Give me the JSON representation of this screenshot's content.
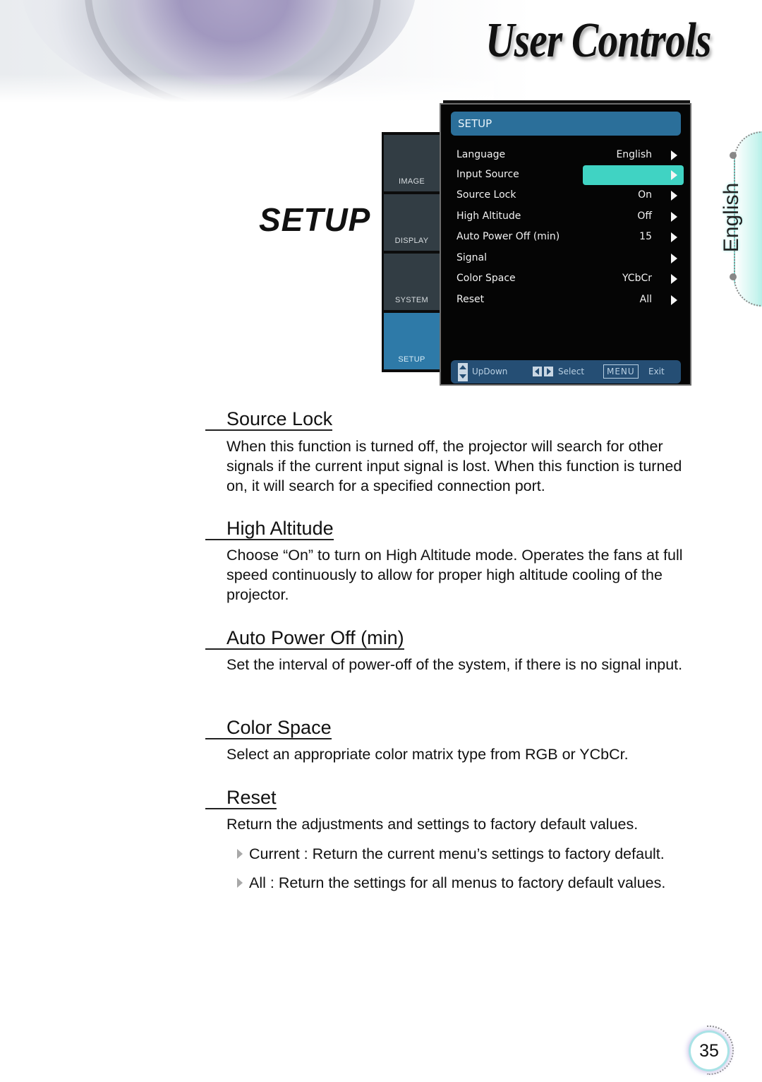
{
  "header": {
    "title": "User Controls"
  },
  "section": {
    "title": "SETUP"
  },
  "osd": {
    "tabs": [
      {
        "label": "IMAGE",
        "active": false
      },
      {
        "label": "DISPLAY",
        "active": false
      },
      {
        "label": "SYSTEM",
        "active": false
      },
      {
        "label": "SETUP",
        "active": true
      }
    ],
    "menu_title": "SETUP",
    "items": [
      {
        "label": "Language",
        "value": "English"
      },
      {
        "label": "Input Source",
        "value": "",
        "highlighted": true
      },
      {
        "label": "Source Lock",
        "value": "On"
      },
      {
        "label": "High Altitude",
        "value": "Off"
      },
      {
        "label": "Auto Power Off (min)",
        "value": "15"
      },
      {
        "label": "Signal",
        "value": ""
      },
      {
        "label": "Color Space",
        "value": "YCbCr"
      },
      {
        "label": "Reset",
        "value": "All"
      }
    ],
    "footer": {
      "updown_label": "UpDown",
      "select_label": "Select",
      "menu_key": "MENU",
      "exit_label": "Exit"
    },
    "colors": {
      "header_bg": "#2b6f9a",
      "highlight": "#40d3c3",
      "active_tab": "#2e7aa8",
      "footer_bg": "#254e74"
    }
  },
  "language_tab": {
    "label": "English"
  },
  "sections": [
    {
      "heading": "Source Lock",
      "body": "When this function is turned off, the projector will search for other signals if the current input signal is lost. When this function is turned on, it will search for a specified connection port."
    },
    {
      "heading": "High Altitude",
      "body": "Choose “On” to turn on High Altitude mode. Operates the fans at full speed continuously to allow for proper high altitude cooling of the projector."
    },
    {
      "heading": "Auto Power Off (min)",
      "body": "Set the interval of power-off of the system, if there is no signal input."
    },
    {
      "heading": "Color Space",
      "body": "Select an appropriate color matrix type from RGB or YCbCr."
    },
    {
      "heading": "Reset",
      "body": "Return the adjustments and settings to factory default values.",
      "bullets": [
        "Current : Return the current menu’s settings to factory default.",
        "All : Return the settings for all menus to factory default values."
      ]
    }
  ],
  "page": {
    "number": "35"
  }
}
